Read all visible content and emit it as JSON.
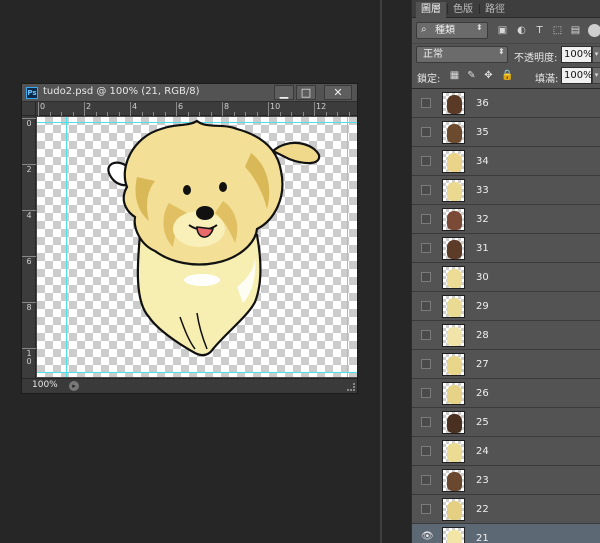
{
  "document": {
    "title": "tudo2.psd @ 100% (21, RGB/8)",
    "app_badge": "Ps",
    "window_buttons": {
      "minimize": "▁",
      "maximize": "□",
      "close": "✕"
    },
    "ruler_h_labels": [
      "0",
      "2",
      "4",
      "6",
      "8",
      "10",
      "12"
    ],
    "ruler_v_labels": [
      "0",
      "2",
      "4",
      "6",
      "8",
      "1\n0"
    ],
    "zoom": "100%",
    "status_arrow": "▸"
  },
  "panel": {
    "tabs": [
      "圖層",
      "色版",
      "路徑"
    ],
    "active_tab": "圖層",
    "filter": {
      "search_icon": "⌕",
      "label": "種類",
      "caret": "⬍"
    },
    "filter_icons": [
      "image-filter-icon",
      "adjustment-filter-icon",
      "text-filter-icon",
      "shape-filter-icon",
      "smartobject-filter-icon"
    ],
    "filter_icon_glyphs": [
      "▣",
      "◐",
      "T",
      "⬚",
      "▤"
    ],
    "blend_mode": "正常",
    "blend_caret": "⬍",
    "opacity_label": "不透明度:",
    "opacity_value": "100%",
    "lock_label": "鎖定:",
    "lock_icon_glyphs": [
      "▦",
      "✎",
      "✥",
      "🔒"
    ],
    "fill_label": "填滿:",
    "fill_value": "100%",
    "spin_caret": "▾",
    "layers": [
      {
        "name": "36",
        "visible": false,
        "selected": false,
        "thumb_color": "#5a3a26"
      },
      {
        "name": "35",
        "visible": false,
        "selected": false,
        "thumb_color": "#6b4a2e"
      },
      {
        "name": "34",
        "visible": false,
        "selected": false,
        "thumb_color": "#e9d48a"
      },
      {
        "name": "33",
        "visible": false,
        "selected": false,
        "thumb_color": "#ead98f"
      },
      {
        "name": "32",
        "visible": false,
        "selected": false,
        "thumb_color": "#7a4a36"
      },
      {
        "name": "31",
        "visible": false,
        "selected": false,
        "thumb_color": "#5c3c28"
      },
      {
        "name": "30",
        "visible": false,
        "selected": false,
        "thumb_color": "#ecdc95"
      },
      {
        "name": "29",
        "visible": false,
        "selected": false,
        "thumb_color": "#eadb94"
      },
      {
        "name": "28",
        "visible": false,
        "selected": false,
        "thumb_color": "#f0e4a8"
      },
      {
        "name": "27",
        "visible": false,
        "selected": false,
        "thumb_color": "#e8d68b"
      },
      {
        "name": "26",
        "visible": false,
        "selected": false,
        "thumb_color": "#e6d388"
      },
      {
        "name": "25",
        "visible": false,
        "selected": false,
        "thumb_color": "#4a3020"
      },
      {
        "name": "24",
        "visible": false,
        "selected": false,
        "thumb_color": "#ecdb93"
      },
      {
        "name": "23",
        "visible": false,
        "selected": false,
        "thumb_color": "#6a4830"
      },
      {
        "name": "22",
        "visible": false,
        "selected": false,
        "thumb_color": "#e4cf82"
      },
      {
        "name": "21",
        "visible": true,
        "selected": true,
        "thumb_color": "#f2e6a6"
      }
    ],
    "eye_glyph": "👁"
  }
}
